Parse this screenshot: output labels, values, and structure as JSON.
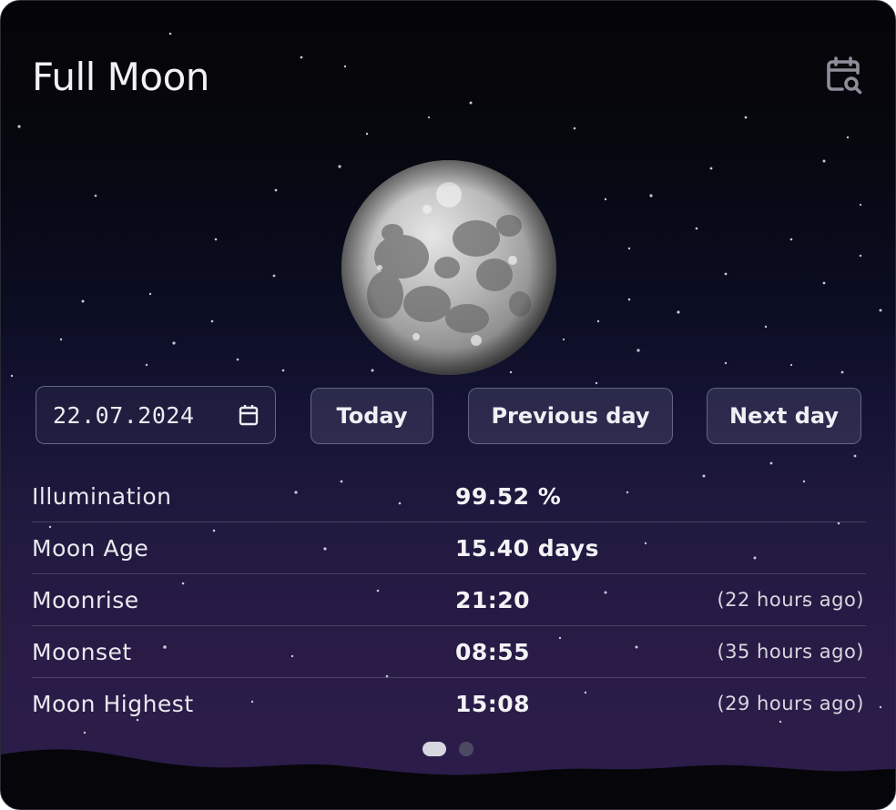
{
  "widget": {
    "title": "Full Moon",
    "calendar_search_icon": "calendar-search-icon"
  },
  "controls": {
    "date_value": "22.07.2024",
    "calendar_icon": "calendar-icon",
    "today_label": "Today",
    "previous_label": "Previous day",
    "next_label": "Next day"
  },
  "info": {
    "rows": [
      {
        "label": "Illumination",
        "value": "99.52 %",
        "relative": ""
      },
      {
        "label": "Moon Age",
        "value": "15.40 days",
        "relative": ""
      },
      {
        "label": "Moonrise",
        "value": "21:20",
        "relative": "(22 hours ago)"
      },
      {
        "label": "Moonset",
        "value": "08:55",
        "relative": "(35 hours ago)"
      },
      {
        "label": "Moon Highest",
        "value": "15:08",
        "relative": "(29 hours ago)"
      }
    ]
  },
  "pager": {
    "pages": 2,
    "active": 1
  },
  "colors": {
    "background_top": "#050507",
    "background_bottom": "#2c1d4a",
    "text": "#f2f2f5",
    "button_bg": "#3a3a55"
  }
}
